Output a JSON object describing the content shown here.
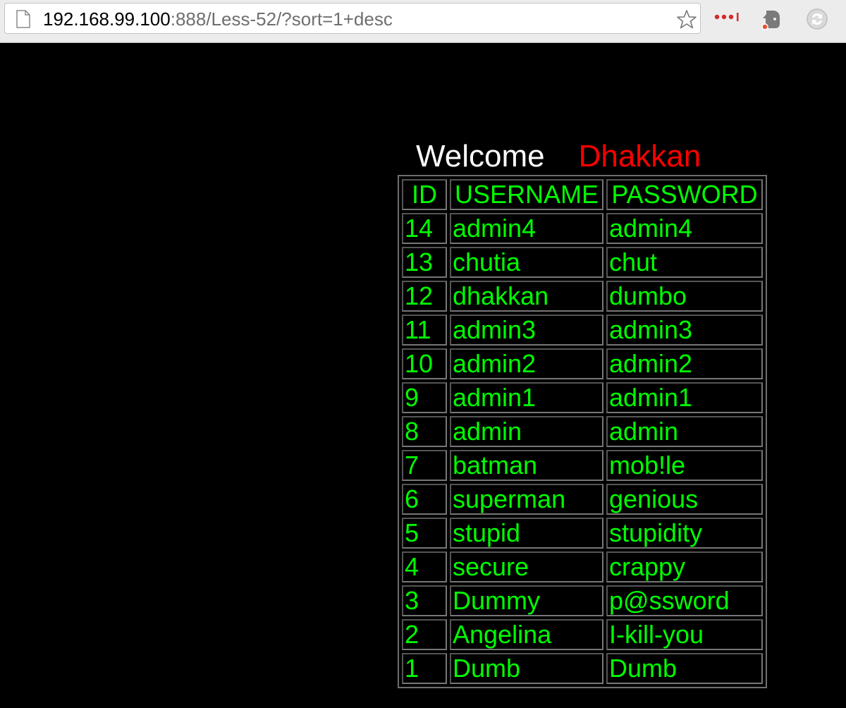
{
  "browser": {
    "url_host": "192.168.99.100",
    "url_rest": ":888/Less-52/?sort=1+desc",
    "icons": [
      "page-icon",
      "bookmark-star-icon",
      "extension-dots-icon",
      "evernote-icon",
      "sync-icon"
    ]
  },
  "page": {
    "welcome_label": "Welcome",
    "user_name": "Dhakkan",
    "colors": {
      "background": "#000000",
      "text_green": "#00ff00",
      "welcome": "#ffffff",
      "user": "#ff0000"
    },
    "table": {
      "headers": {
        "id": "ID",
        "username": "USERNAME",
        "password": "PASSWORD"
      },
      "rows": [
        {
          "id": "14",
          "username": "admin4",
          "password": "admin4"
        },
        {
          "id": "13",
          "username": "chutia",
          "password": "chut"
        },
        {
          "id": "12",
          "username": "dhakkan",
          "password": "dumbo"
        },
        {
          "id": "11",
          "username": "admin3",
          "password": "admin3"
        },
        {
          "id": "10",
          "username": "admin2",
          "password": "admin2"
        },
        {
          "id": "9",
          "username": "admin1",
          "password": "admin1"
        },
        {
          "id": "8",
          "username": "admin",
          "password": "admin"
        },
        {
          "id": "7",
          "username": "batman",
          "password": "mob!le"
        },
        {
          "id": "6",
          "username": "superman",
          "password": "genious"
        },
        {
          "id": "5",
          "username": "stupid",
          "password": "stupidity"
        },
        {
          "id": "4",
          "username": "secure",
          "password": "crappy"
        },
        {
          "id": "3",
          "username": "Dummy",
          "password": "p@ssword"
        },
        {
          "id": "2",
          "username": "Angelina",
          "password": "I-kill-you"
        },
        {
          "id": "1",
          "username": "Dumb",
          "password": "Dumb"
        }
      ]
    }
  }
}
